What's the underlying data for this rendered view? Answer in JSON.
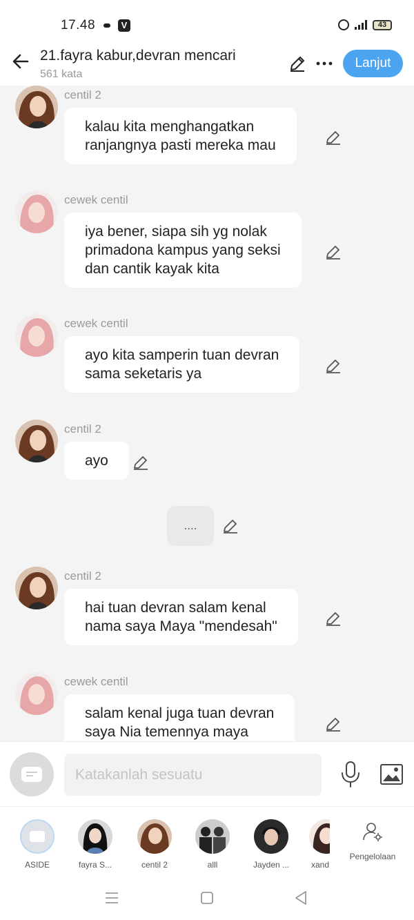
{
  "status_bar": {
    "time": "17.48",
    "battery": "43",
    "app_badge": "V",
    "icons": [
      "cloud-icon",
      "app-v-icon",
      "alarm-icon",
      "signal-icon",
      "battery-icon"
    ]
  },
  "header": {
    "title": "21.fayra kabur,devran mencari",
    "word_count": "561 kata",
    "next_button": "Lanjut",
    "icons": [
      "back-arrow-icon",
      "pencil-icon",
      "more-dots-icon"
    ]
  },
  "messages": [
    {
      "sender": "centil 2",
      "lines": [
        "kalau kita menghangatkan",
        "ranjangnya pasti mereka mau"
      ],
      "avatar": "brunette-avatar"
    },
    {
      "sender": "cewek centil",
      "lines": [
        "iya bener, siapa sih yg nolak",
        "primadona kampus yang seksi",
        "dan cantik kayak kita"
      ],
      "avatar": "pink-hair-avatar"
    },
    {
      "sender": "cewek centil",
      "lines": [
        "ayo kita samperin tuan devran",
        "sama seketaris ya"
      ],
      "avatar": "pink-hair-avatar"
    },
    {
      "sender": "centil 2",
      "lines": [
        "ayo"
      ],
      "avatar": "brunette-avatar"
    },
    {
      "sender": "",
      "lines": [
        "...."
      ],
      "avatar": "none",
      "type": "narration"
    },
    {
      "sender": "centil 2",
      "lines": [
        "hai tuan devran salam kenal",
        "nama saya Maya \"mendesah\""
      ],
      "avatar": "brunette-avatar"
    },
    {
      "sender": "cewek centil",
      "lines": [
        "salam kenal juga tuan devran",
        "saya Nia temennya maya"
      ],
      "avatar": "pink-hair-avatar"
    }
  ],
  "input": {
    "placeholder": "Katakanlah sesuatu",
    "icons": [
      "aside-chip-icon",
      "microphone-icon",
      "image-icon"
    ]
  },
  "characters": [
    {
      "label": "ASIDE",
      "avatar": "aside-chip-icon"
    },
    {
      "label": "fayra S...",
      "avatar": "black-hair-avatar"
    },
    {
      "label": "centil 2",
      "avatar": "brunette-avatar"
    },
    {
      "label": "alll",
      "avatar": "group-avatar"
    },
    {
      "label": "Jayden ...",
      "avatar": "man-avatar"
    },
    {
      "label": "xand",
      "avatar": "woman-avatar"
    }
  ],
  "manage": {
    "label": "Pengelolaan",
    "icon": "person-gear-icon"
  },
  "nav": {
    "icons": [
      "menu-icon",
      "home-icon",
      "back-icon"
    ]
  },
  "colors": {
    "accent": "#4ca3f0",
    "background": "#f4f4f4",
    "bubble": "#ffffff",
    "narration": "#e9e9e9"
  }
}
